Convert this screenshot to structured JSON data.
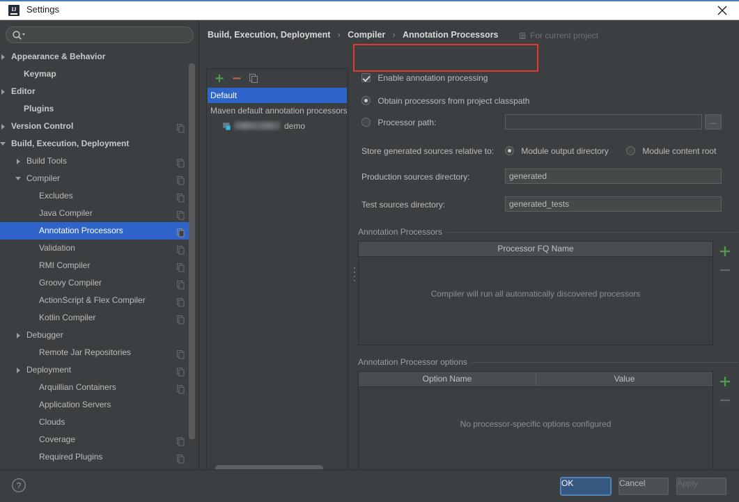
{
  "window": {
    "title": "Settings",
    "app_icon": "intellij-idea-icon",
    "close_icon": "close-icon"
  },
  "sidebar": {
    "search": {
      "placeholder": "",
      "value": "",
      "icon": "search-icon"
    },
    "items": [
      {
        "label": "Appearance & Behavior",
        "indent": 8,
        "arrow": "collapsed",
        "bold": true,
        "copy": false
      },
      {
        "label": "Keymap",
        "indent": 26,
        "arrow": "none",
        "bold": true,
        "copy": false
      },
      {
        "label": "Editor",
        "indent": 8,
        "arrow": "collapsed",
        "bold": true,
        "copy": false
      },
      {
        "label": "Plugins",
        "indent": 26,
        "arrow": "none",
        "bold": true,
        "copy": false
      },
      {
        "label": "Version Control",
        "indent": 8,
        "arrow": "collapsed",
        "bold": true,
        "copy": true
      },
      {
        "label": "Build, Execution, Deployment",
        "indent": 8,
        "arrow": "expanded",
        "bold": true,
        "copy": false
      },
      {
        "label": "Build Tools",
        "indent": 30,
        "arrow": "collapsed",
        "bold": false,
        "copy": true
      },
      {
        "label": "Compiler",
        "indent": 30,
        "arrow": "expanded",
        "bold": false,
        "copy": true
      },
      {
        "label": "Excludes",
        "indent": 48,
        "arrow": "none",
        "bold": false,
        "copy": true
      },
      {
        "label": "Java Compiler",
        "indent": 48,
        "arrow": "none",
        "bold": false,
        "copy": true
      },
      {
        "label": "Annotation Processors",
        "indent": 48,
        "arrow": "none",
        "bold": false,
        "copy": true,
        "selected": true
      },
      {
        "label": "Validation",
        "indent": 48,
        "arrow": "none",
        "bold": false,
        "copy": true
      },
      {
        "label": "RMI Compiler",
        "indent": 48,
        "arrow": "none",
        "bold": false,
        "copy": true
      },
      {
        "label": "Groovy Compiler",
        "indent": 48,
        "arrow": "none",
        "bold": false,
        "copy": true
      },
      {
        "label": "ActionScript & Flex Compiler",
        "indent": 48,
        "arrow": "none",
        "bold": false,
        "copy": true
      },
      {
        "label": "Kotlin Compiler",
        "indent": 48,
        "arrow": "none",
        "bold": false,
        "copy": true
      },
      {
        "label": "Debugger",
        "indent": 30,
        "arrow": "collapsed",
        "bold": false,
        "copy": false
      },
      {
        "label": "Remote Jar Repositories",
        "indent": 48,
        "arrow": "none",
        "bold": false,
        "copy": true
      },
      {
        "label": "Deployment",
        "indent": 30,
        "arrow": "collapsed",
        "bold": false,
        "copy": true
      },
      {
        "label": "Arquillian Containers",
        "indent": 48,
        "arrow": "none",
        "bold": false,
        "copy": true
      },
      {
        "label": "Application Servers",
        "indent": 48,
        "arrow": "none",
        "bold": false,
        "copy": false
      },
      {
        "label": "Clouds",
        "indent": 48,
        "arrow": "none",
        "bold": false,
        "copy": false
      },
      {
        "label": "Coverage",
        "indent": 48,
        "arrow": "none",
        "bold": false,
        "copy": true
      },
      {
        "label": "Required Plugins",
        "indent": 48,
        "arrow": "none",
        "bold": false,
        "copy": true
      }
    ]
  },
  "breadcrumb": {
    "crumb1": "Build, Execution, Deployment",
    "sep1": "›",
    "crumb2": "Compiler",
    "sep2": "›",
    "crumb3": "Annotation Processors",
    "scope_label": "For current project",
    "scope_icon": "project-scope-icon"
  },
  "profiles": {
    "toolbar": {
      "add_label": "+",
      "remove_label": "−",
      "copy_icon": "copy-profile-icon",
      "add_icon": "add-icon",
      "remove_icon": "remove-icon"
    },
    "rows": [
      {
        "label": "Default",
        "selected": true,
        "child": false
      },
      {
        "label": "Maven default annotation processors profile",
        "selected": false,
        "child": false
      },
      {
        "label": "demo",
        "selected": false,
        "child": true,
        "redacted": true,
        "icon": "module-icon"
      }
    ]
  },
  "settings": {
    "enable_processing": {
      "label": "Enable annotation processing",
      "checked": true
    },
    "source_group": {
      "obtain_from_classpath": {
        "label": "Obtain processors from project classpath",
        "selected": true
      },
      "processor_path": {
        "label": "Processor path:",
        "selected": false,
        "value": "",
        "browse_label": "..."
      }
    },
    "store_relative": {
      "label": "Store generated sources relative to:",
      "module_output": {
        "label": "Module output directory",
        "selected": true
      },
      "module_content": {
        "label": "Module content root",
        "selected": false
      }
    },
    "production_dir": {
      "label": "Production sources directory:",
      "value": "generated"
    },
    "test_dir": {
      "label": "Test sources directory:",
      "value": "generated_tests"
    },
    "processors_table": {
      "title": "Annotation Processors",
      "columns": [
        "Processor FQ Name"
      ],
      "empty_text": "Compiler will run all automatically discovered processors",
      "rows": [],
      "add_label": "+",
      "remove_label": "−"
    },
    "options_table": {
      "title": "Annotation Processor options",
      "columns": [
        "Option Name",
        "Value"
      ],
      "empty_text": "No processor-specific options configured",
      "rows": [],
      "add_label": "+",
      "remove_label": "−"
    }
  },
  "footer": {
    "help_label": "?",
    "ok": "OK",
    "cancel": "Cancel",
    "apply": "Apply",
    "apply_enabled": false
  },
  "colors": {
    "background": "#3c3f41",
    "selection": "#2f65ca",
    "primary_button": "#365880",
    "annotation_red": "#e23a2e",
    "add_green": "#3c9a3c",
    "titlebar": "#ffffff"
  }
}
